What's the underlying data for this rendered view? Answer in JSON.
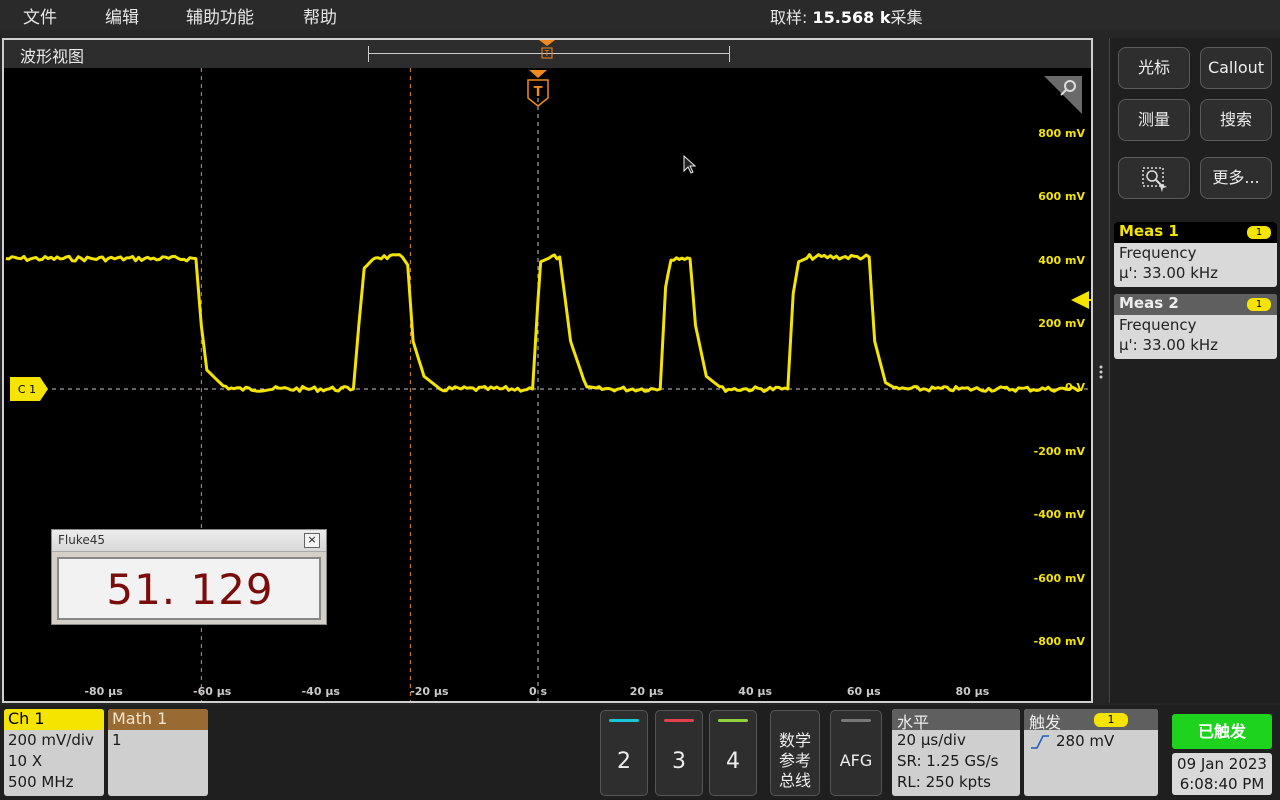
{
  "menu": {
    "items": [
      "文件",
      "编辑",
      "辅助功能",
      "帮助"
    ]
  },
  "acquisition": {
    "label": "取样:",
    "value": "15.568 k",
    "suffix": "采集"
  },
  "waveform_view": {
    "title": "波形视图",
    "trigger_marker": "T",
    "channel_marker": "C 1",
    "y_labels": [
      "800 mV",
      "600 mV",
      "400 mV",
      "200 mV",
      "0 V",
      "-200 mV",
      "-400 mV",
      "-600 mV",
      "-800 mV"
    ],
    "x_labels": [
      "-80 µs",
      "-60 µs",
      "-40 µs",
      "-20 µs",
      "0 s",
      "20 µs",
      "40 µs",
      "60 µs",
      "80 µs"
    ],
    "trace_color": "#f4e400"
  },
  "chart_data": {
    "type": "line",
    "title": "",
    "xlabel": "",
    "ylabel": "",
    "x_unit": "µs",
    "y_unit": "mV",
    "xlim": [
      -98,
      100
    ],
    "ylim": [
      -1000,
      1000
    ],
    "series": [
      {
        "x": [
          -98,
          -63,
          -62,
          -61,
          -58,
          -56,
          -34,
          -33,
          -32,
          -30,
          -25,
          -24,
          -23,
          -21,
          -18,
          -1,
          0,
          0.5,
          2.5,
          4,
          6,
          9,
          22.5,
          23.5,
          24.5,
          26,
          28,
          29,
          31,
          34,
          46,
          47,
          48,
          50,
          61,
          62,
          64,
          66,
          100
        ],
        "values": [
          410,
          410,
          200,
          60,
          10,
          0,
          0,
          200,
          380,
          415,
          415,
          390,
          150,
          40,
          0,
          0,
          280,
          400,
          415,
          415,
          150,
          0,
          0,
          320,
          410,
          415,
          410,
          200,
          40,
          0,
          0,
          300,
          400,
          415,
          415,
          150,
          20,
          0,
          0
        ]
      }
    ],
    "cursors_x": [
      -62,
      -23.5
    ],
    "trigger_x": 0,
    "trigger_level": 280,
    "grid": false
  },
  "fluke": {
    "title": "Fluke45",
    "close": "×",
    "reading": "51. 129"
  },
  "right_panel": {
    "cursor_label": "光标",
    "callout_label": "Callout",
    "measure_label": "测量",
    "search_label": "搜索",
    "more_label": "更多...",
    "meas": [
      {
        "title": "Meas 1",
        "badge": "1",
        "type": "Frequency",
        "value": "µ': 33.00 kHz"
      },
      {
        "title": "Meas 2",
        "badge": "1",
        "type": "Frequency",
        "value": "µ': 33.00 kHz"
      }
    ]
  },
  "bottom": {
    "ch1": {
      "title": "Ch 1",
      "scale": "200 mV/div",
      "probe": "10 X",
      "bw": "500 MHz"
    },
    "math1": {
      "title": "Math 1",
      "value": "1"
    },
    "channels": [
      {
        "num": "2",
        "color": "#19c6d6"
      },
      {
        "num": "3",
        "color": "#e2404c"
      },
      {
        "num": "4",
        "color": "#8fd13b"
      }
    ],
    "math_ref_bus": [
      "数学",
      "参考",
      "总线"
    ],
    "afg": "AFG",
    "horizontal": {
      "title": "水平",
      "scale": "20 µs/div",
      "sr": "SR: 1.25 GS/s",
      "rl": "RL: 250 kpts"
    },
    "trigger": {
      "title": "触发",
      "badge": "1",
      "level": "280 mV"
    },
    "triggered": "已触发",
    "date": "09 Jan 2023",
    "time": "6:08:40 PM"
  }
}
